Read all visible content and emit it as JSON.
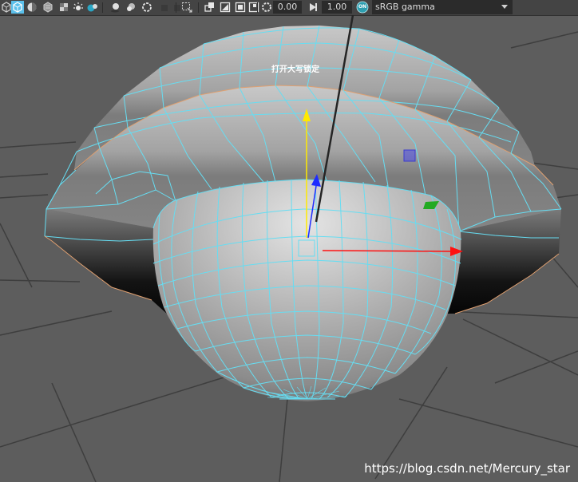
{
  "toolbar": {
    "exposure_value": "0.00",
    "gamma_value": "1.00",
    "color_management_badge": "ON",
    "color_space": "sRGB gamma",
    "icons": [
      "object-cube-icon",
      "wireframe-cube-icon",
      "textured-cube-icon",
      "lights-icon",
      "gradient-icon",
      "shadow-sphere-icon",
      "ambient-occlusion-icon",
      "motion-blur-icon",
      "ring-icon",
      "isolate-select-icon",
      "xray-icon",
      "grid-icon",
      "film-gate-icon",
      "resolution-gate-icon",
      "safe-area-icon",
      "exposure-icon",
      "gamma-icon",
      "color-management-icon",
      "dropdown-chevron-icon"
    ],
    "colors": {
      "background": "#444444",
      "field": "#2b2b2b",
      "active_blue": "#5bc0eb",
      "badge_teal": "#2d9fb0"
    }
  },
  "viewport": {
    "ime_indicator": "打开大写锁定",
    "watermark": "https://blog.csdn.net/Mercury_star",
    "colors": {
      "background": "#5d5d5d",
      "grid": "#3f3f3f",
      "wire": "#66ddf2",
      "border_edge": "#e0a070",
      "manip_x": "#ff1010",
      "manip_y": "#ffea00",
      "manip_z": "#1e2bff"
    }
  }
}
